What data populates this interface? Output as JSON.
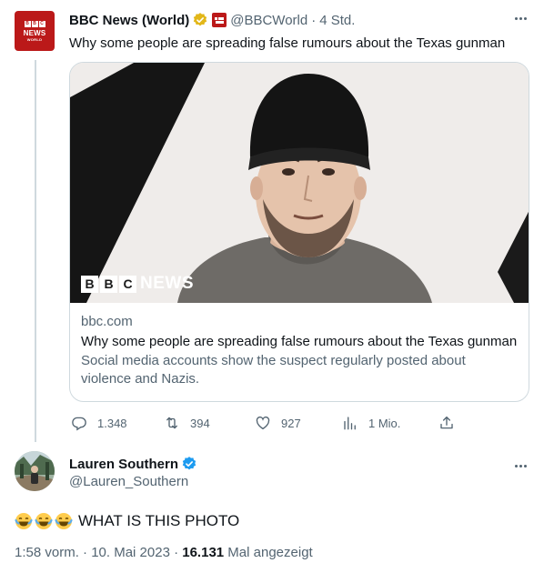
{
  "parent_tweet": {
    "author_name": "BBC News (World)",
    "handle": "@BBCWorld",
    "separator": "·",
    "time_ago": "4 Std.",
    "avatar_label": {
      "blocks": [
        "B",
        "B",
        "C"
      ],
      "news": "NEWS",
      "world": "WORLD"
    },
    "text": "Why some people are spreading false rumours about the Texas gunman",
    "card": {
      "logo_blocks": [
        "B",
        "B",
        "C"
      ],
      "logo_text": "NEWS",
      "domain": "bbc.com",
      "title": "Why some people are spreading false rumours about the Texas gunman",
      "description": "Social media accounts show the suspect regularly posted about violence and Nazis."
    },
    "actions": {
      "replies": "1.348",
      "reposts": "394",
      "likes": "927",
      "views": "1 Mio."
    }
  },
  "main_tweet": {
    "author_name": "Lauren Southern",
    "handle": "@Lauren_Southern",
    "emojis": [
      "face-with-tears-of-joy",
      "face-with-tears-of-joy",
      "face-with-tears-of-joy"
    ],
    "text": "WHAT IS THIS PHOTO",
    "timestamp": "1:58 vorm. · 10. Mai 2023 · ",
    "view_count": "16.131",
    "view_label": " Mal angezeigt"
  },
  "colors": {
    "text_primary": "#0f1419",
    "text_secondary": "#536471",
    "border": "#cfd9de",
    "bbc_red": "#bb1919",
    "verified_blue": "#1d9bf0",
    "verified_gold": "#e2b719"
  }
}
